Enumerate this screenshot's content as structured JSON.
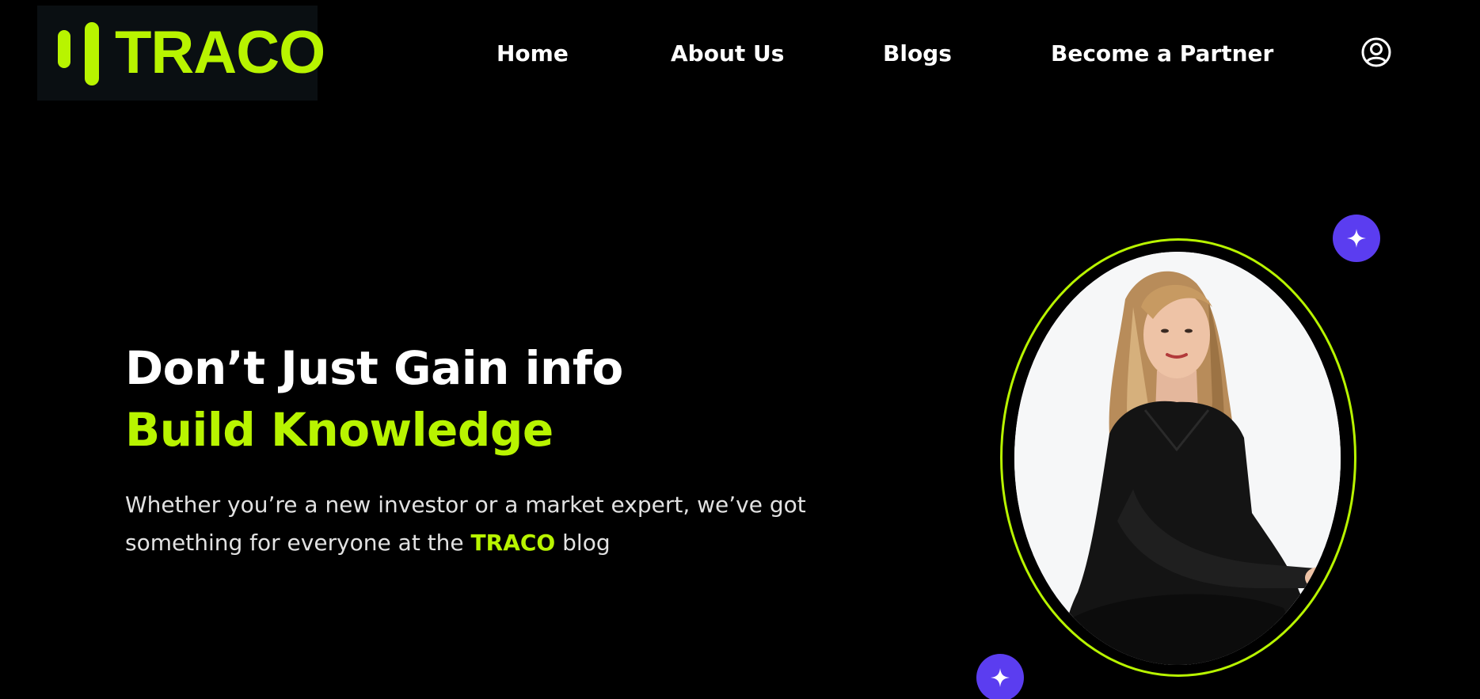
{
  "brand": {
    "logo_text": "TRACO",
    "accent_color": "#b8f400",
    "logo_mark_icon": "double-bar-mark"
  },
  "nav": {
    "items": [
      {
        "label": "Home"
      },
      {
        "label": "About Us"
      },
      {
        "label": "Blogs"
      },
      {
        "label": "Become a Partner"
      }
    ],
    "account_icon": "user-circle-icon"
  },
  "hero": {
    "title_line1": "Don’t Just Gain info",
    "title_line2": "Build Knowledge",
    "description_part1": "Whether you’re a new investor or a market expert, we’ve got something for everyone at the ",
    "description_brand": "TRACO",
    "description_part2": " blog",
    "portrait_image": "smiling woman with long blonde hair in black outfit, seated",
    "decoration_icon": "sparkle-icon",
    "decoration_color": "#5b3df0"
  }
}
